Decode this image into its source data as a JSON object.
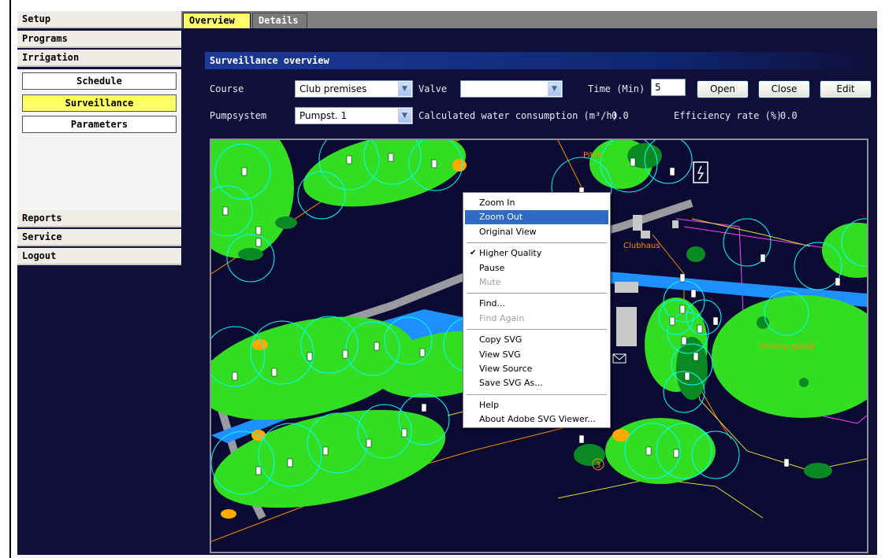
{
  "nav": {
    "top": [
      "Setup",
      "Programs",
      "Irrigation"
    ],
    "irrigation_sub": [
      {
        "label": "Schedule",
        "active": false
      },
      {
        "label": "Surveillance",
        "active": true
      },
      {
        "label": "Parameters",
        "active": false
      }
    ],
    "bottom": [
      "Reports",
      "Service",
      "Logout"
    ]
  },
  "tabs": [
    {
      "label": "Overview",
      "active": true
    },
    {
      "label": "Details",
      "active": false
    }
  ],
  "section_title": "Surveillance overview",
  "controls": {
    "course_label": "Course",
    "course_value": "Club premises",
    "valve_label": "Valve",
    "valve_value": "",
    "time_label": "Time (Min)",
    "time_value": "5",
    "open_label": "Open",
    "close_label": "Close",
    "edit_label": "Edit",
    "pumpsystem_label": "Pumpsystem",
    "pumpsystem_value": "Pumpst. 1",
    "consumption_label": "Calculated water consumption (m³/h)",
    "consumption_value": "0.0",
    "efficiency_label": "Efficiency rate (%)",
    "efficiency_value": "0.0"
  },
  "map_labels": {
    "pitch": "Pitch",
    "clubhaus": "Clubhaus",
    "driving_range": "Driving Range",
    "hole_marker": "3"
  },
  "context_menu": [
    {
      "label": "Zoom In",
      "state": "normal"
    },
    {
      "label": "Zoom Out",
      "state": "highlighted"
    },
    {
      "label": "Original View",
      "state": "normal"
    },
    {
      "separator": true
    },
    {
      "label": "Higher Quality",
      "state": "checked"
    },
    {
      "label": "Pause",
      "state": "normal"
    },
    {
      "label": "Mute",
      "state": "disabled"
    },
    {
      "separator": true
    },
    {
      "label": "Find...",
      "state": "normal"
    },
    {
      "label": "Find Again",
      "state": "disabled"
    },
    {
      "separator": true
    },
    {
      "label": "Copy SVG",
      "state": "normal"
    },
    {
      "label": "View SVG",
      "state": "normal"
    },
    {
      "label": "View Source",
      "state": "normal"
    },
    {
      "label": "Save SVG As...",
      "state": "normal"
    },
    {
      "separator": true
    },
    {
      "label": "Help",
      "state": "normal"
    },
    {
      "label": "About Adobe SVG Viewer...",
      "state": "normal"
    }
  ],
  "colors": {
    "background": "#0f0f3a",
    "active_yellow": "#ffff66",
    "turf_green": "#33dd22",
    "water_blue": "#1e90ff",
    "sprinkler_cyan": "#00ffff",
    "pipe_orange": "#ff8c00",
    "menu_highlight": "#316ac5"
  },
  "icons": [
    "dropdown-arrow-icon",
    "sprinkler-valve-icon",
    "electric-box-icon",
    "checkmark-icon",
    "envelope-icon"
  ]
}
